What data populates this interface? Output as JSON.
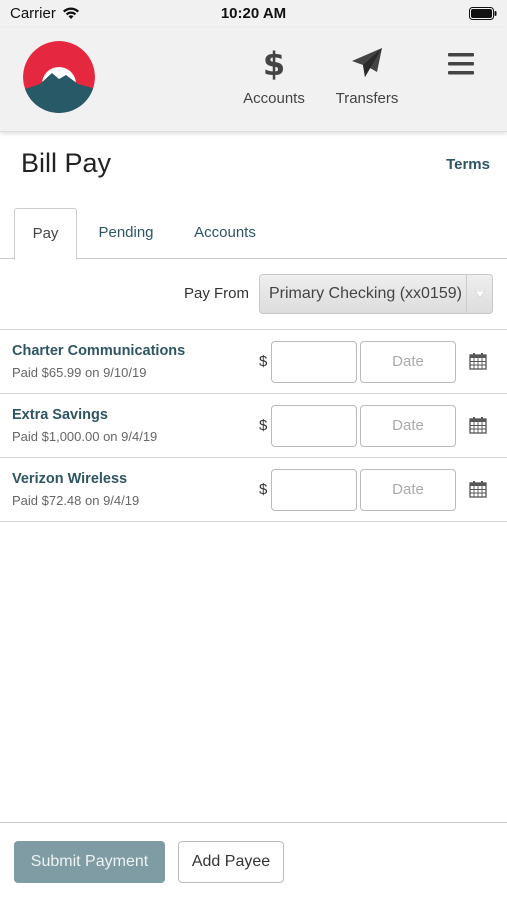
{
  "status_bar": {
    "carrier": "Carrier",
    "time": "10:20 AM"
  },
  "header": {
    "nav": [
      {
        "label": "Accounts",
        "icon": "dollar-icon"
      },
      {
        "label": "Transfers",
        "icon": "paper-plane-icon"
      }
    ],
    "menu_icon": "hamburger-menu-icon",
    "logo_colors": {
      "ring": "#e5283f",
      "mountain": "#285967"
    }
  },
  "page": {
    "title": "Bill Pay",
    "terms_label": "Terms"
  },
  "tabs": [
    {
      "label": "Pay",
      "active": true
    },
    {
      "label": "Pending",
      "active": false
    },
    {
      "label": "Accounts",
      "active": false
    }
  ],
  "pay_from": {
    "label": "Pay From",
    "selected": "Primary Checking (xx0159)"
  },
  "payees": [
    {
      "name": "Charter Communications",
      "last_paid": "Paid $65.99 on 9/10/19",
      "currency": "$",
      "amount": "",
      "date_placeholder": "Date"
    },
    {
      "name": "Extra Savings",
      "last_paid": "Paid $1,000.00 on 9/4/19",
      "currency": "$",
      "amount": "",
      "date_placeholder": "Date"
    },
    {
      "name": "Verizon Wireless",
      "last_paid": "Paid $72.48 on 9/4/19",
      "currency": "$",
      "amount": "",
      "date_placeholder": "Date"
    }
  ],
  "footer": {
    "submit_label": "Submit Payment",
    "add_payee_label": "Add Payee"
  },
  "colors": {
    "accent": "#2f5563",
    "submit_bg": "#7f9ba3"
  }
}
